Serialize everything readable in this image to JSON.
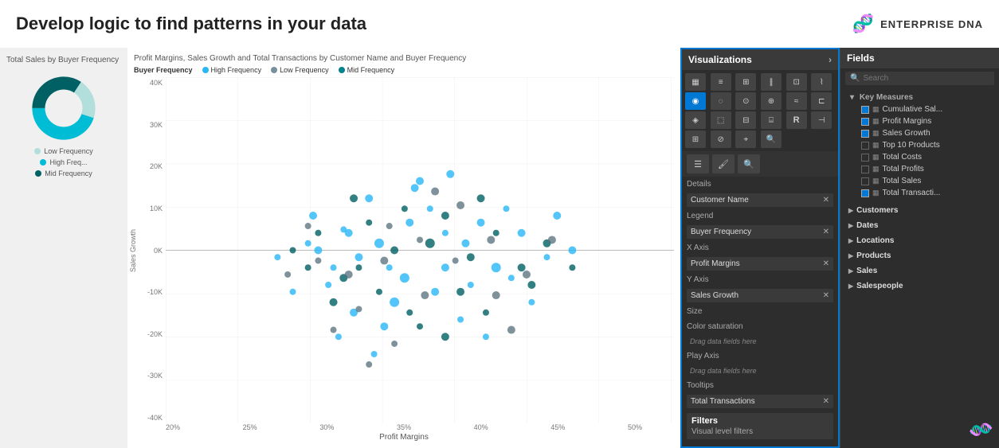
{
  "header": {
    "title": "Develop logic to find patterns in your data",
    "logo_symbol": "🧬",
    "logo_text": "ENTERPRISE DNA"
  },
  "left_panel": {
    "title": "Total Sales by Buyer Frequency",
    "legend": [
      {
        "label": "Low Frequency",
        "color": "#b2dfdb"
      },
      {
        "label": "High Freq...",
        "color": "#00bcd4"
      },
      {
        "label": "Mid Frequency",
        "color": "#006064"
      }
    ],
    "donut": {
      "segments": [
        {
          "color": "#b2dfdb",
          "pct": 30
        },
        {
          "color": "#00bcd4",
          "pct": 45
        },
        {
          "color": "#006064",
          "pct": 25
        }
      ]
    }
  },
  "chart": {
    "title": "Profit Margins, Sales Growth and Total Transactions by Customer Name and Buyer Frequency",
    "legend_label": "Buyer Frequency",
    "legend_items": [
      {
        "label": "High Frequency",
        "color": "#29b6f6"
      },
      {
        "label": "Low Frequency",
        "color": "#78909c"
      },
      {
        "label": "Mid Frequency",
        "color": "#00838f"
      }
    ],
    "x_axis_label": "Profit Margins",
    "y_axis_label": "Sales Growth",
    "x_ticks": [
      "20%",
      "25%",
      "30%",
      "35%",
      "40%",
      "45%",
      "50%"
    ],
    "y_ticks": [
      "40K",
      "30K",
      "20K",
      "10K",
      "0K",
      "-10K",
      "-20K",
      "-30K",
      "-40K"
    ]
  },
  "visualizations": {
    "header": "Visualizations",
    "icons": [
      "▦",
      "≡",
      "⊞",
      "∥",
      "⊡",
      "⌇",
      "◉",
      "◌",
      "⊙",
      "⊕",
      "≈",
      "⊏",
      "◈",
      "⬚",
      "⊟",
      "⌸",
      "R",
      "⊣",
      "⊞",
      "⊘",
      "⌖",
      "🔍"
    ],
    "tools": [
      "≡",
      "🔧",
      "🔍"
    ],
    "sections": {
      "details": {
        "label": "Details",
        "field": "Customer Name"
      },
      "legend": {
        "label": "Legend",
        "field": "Buyer Frequency"
      },
      "x_axis": {
        "label": "X Axis",
        "field": "Profit Margins"
      },
      "y_axis": {
        "label": "Y Axis",
        "field": "Sales Growth"
      },
      "size": {
        "label": "Size",
        "field": ""
      },
      "color_saturation": {
        "label": "Color saturation",
        "drag": "Drag data fields here"
      },
      "play_axis": {
        "label": "Play Axis",
        "drag": "Drag data fields here"
      },
      "tooltips": {
        "label": "Tooltips",
        "field": "Total Transactions"
      }
    },
    "filters": {
      "label": "Filters",
      "sub": "Visual level filters"
    }
  },
  "fields": {
    "header": "Fields",
    "search_placeholder": "Search",
    "key_measures_label": "Key Measures",
    "key_measures_items": [
      {
        "label": "Cumulative Sal...",
        "checked": true
      },
      {
        "label": "Profit Margins",
        "checked": true
      },
      {
        "label": "Sales Growth",
        "checked": true
      },
      {
        "label": "Top 10 Products",
        "checked": false
      },
      {
        "label": "Total Costs",
        "checked": false
      },
      {
        "label": "Total Profits",
        "checked": false
      },
      {
        "label": "Total Sales",
        "checked": false
      },
      {
        "label": "Total Transacti...",
        "checked": true
      }
    ],
    "groups": [
      {
        "label": "Customers",
        "color": "#ffa726"
      },
      {
        "label": "Dates",
        "color": "#ffa726"
      },
      {
        "label": "Locations",
        "color": "#ffa726"
      },
      {
        "label": "Products",
        "color": "#ffa726"
      },
      {
        "label": "Sales",
        "color": "#ffa726"
      },
      {
        "label": "Salespeople",
        "color": "#ffa726"
      }
    ]
  }
}
